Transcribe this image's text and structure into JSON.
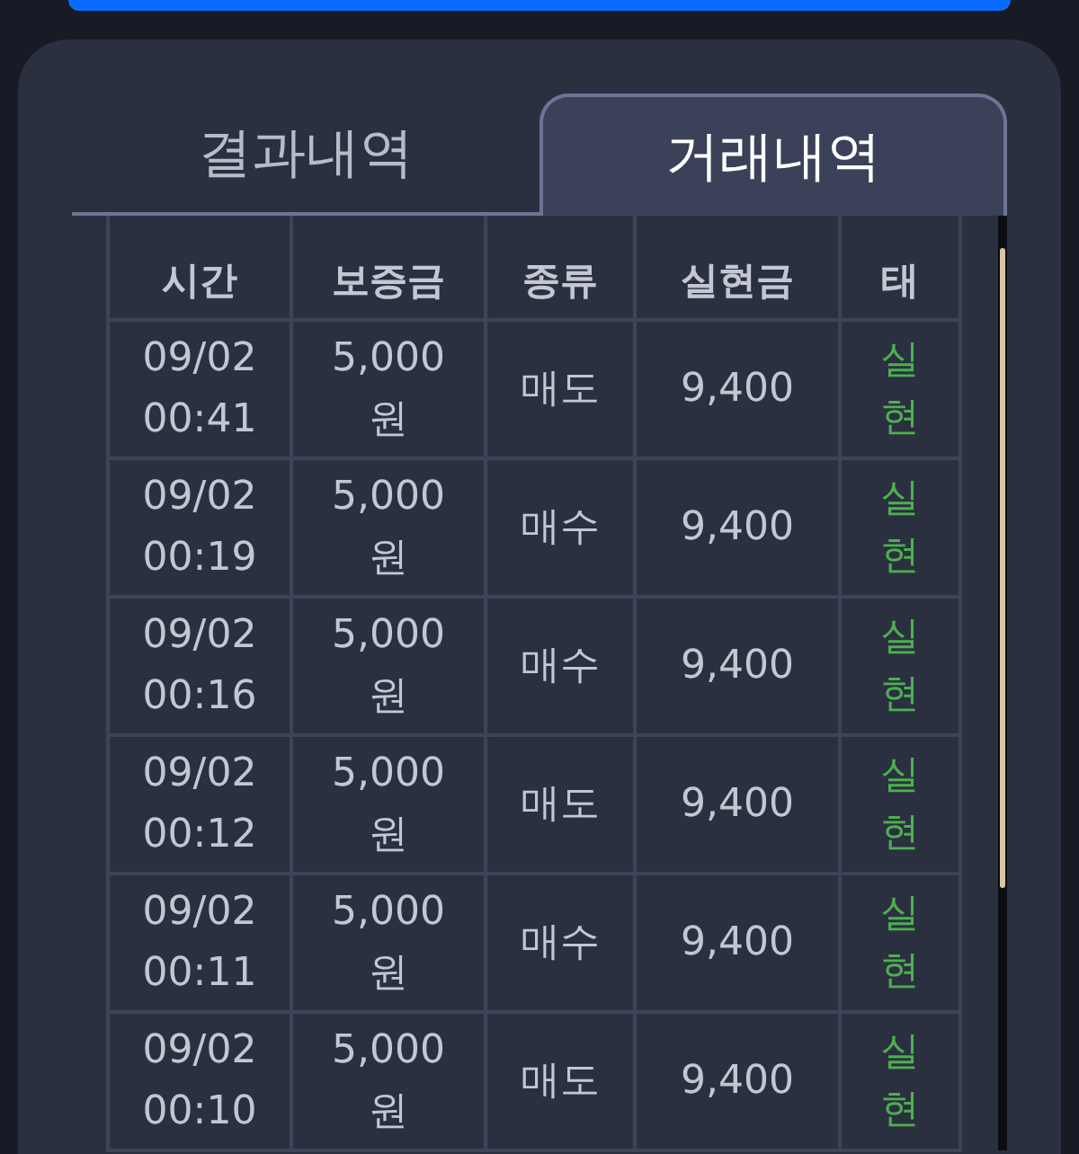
{
  "tabs": [
    {
      "label": "결과내역",
      "selected": false
    },
    {
      "label": "거래내역",
      "selected": true
    }
  ],
  "table": {
    "columns": [
      "시간",
      "보증금",
      "종류",
      "실현금",
      "태"
    ],
    "rows": [
      {
        "time": "09/02 00:41",
        "margin": "5,000 원",
        "type": "매도",
        "amount": "9,400",
        "status": "실현"
      },
      {
        "time": "09/02 00:19",
        "margin": "5,000 원",
        "type": "매수",
        "amount": "9,400",
        "status": "실현"
      },
      {
        "time": "09/02 00:16",
        "margin": "5,000 원",
        "type": "매수",
        "amount": "9,400",
        "status": "실현"
      },
      {
        "time": "09/02 00:12",
        "margin": "5,000 원",
        "type": "매도",
        "amount": "9,400",
        "status": "실현"
      },
      {
        "time": "09/02 00:11",
        "margin": "5,000 원",
        "type": "매수",
        "amount": "9,400",
        "status": "실현"
      },
      {
        "time": "09/02 00:10",
        "margin": "5,000 원",
        "type": "매도",
        "amount": "9,400",
        "status": "실현"
      }
    ]
  }
}
